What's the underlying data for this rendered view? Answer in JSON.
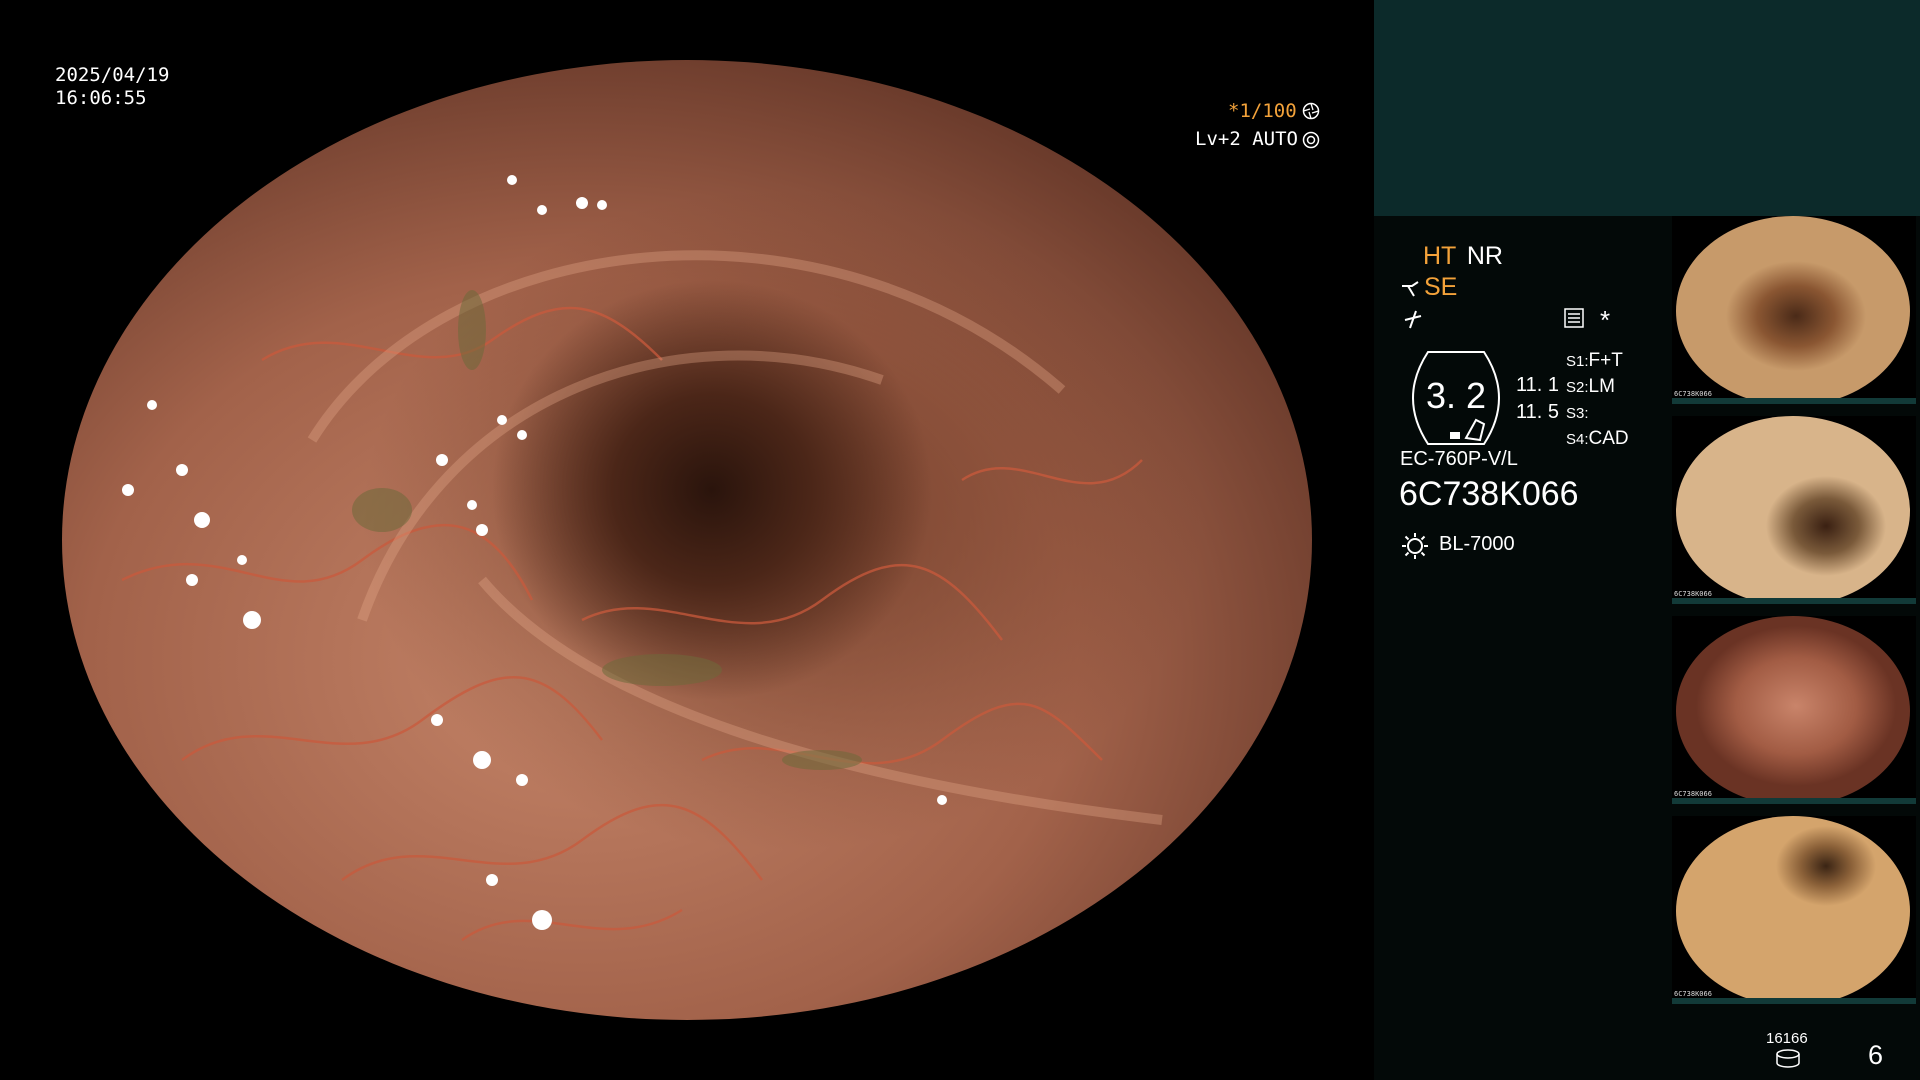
{
  "overlay": {
    "date": "2025/04/19",
    "time": "16:06:55",
    "shutter": "*1/100",
    "level": "Lv+2 AUTO"
  },
  "panel": {
    "ht": "HT",
    "nr": "NR",
    "se": "SE",
    "asterisk": "*",
    "zoom_value": "3. 2",
    "val_a": "11. 1",
    "val_b": "11. 5",
    "s1_key": "S1:",
    "s1_val": "F+T",
    "s2_key": "S2:",
    "s2_val": "LM",
    "s3_key": "S3:",
    "s3_val": "",
    "s4_key": "S4:",
    "s4_val": "CAD",
    "scope_model": "EC-760P-V/L",
    "scope_serial": "6C738K066",
    "light_source": "BL-7000",
    "storage_count": "16166",
    "page_number": "6"
  },
  "thumbnails": [
    {
      "caption": "6C738K066"
    },
    {
      "caption": "6C738K066"
    },
    {
      "caption": "6C738K066"
    },
    {
      "caption": "6C738K066"
    }
  ],
  "colors": {
    "accent_orange": "#f3a23a",
    "panel_bg": "#030908",
    "panel_top": "#0c2a2a"
  },
  "icons": [
    "aperture-icon",
    "iris-icon",
    "scope-tip-icon",
    "function-icon",
    "settings-panel-icon",
    "light-bulb-icon",
    "storage-disk-icon"
  ]
}
